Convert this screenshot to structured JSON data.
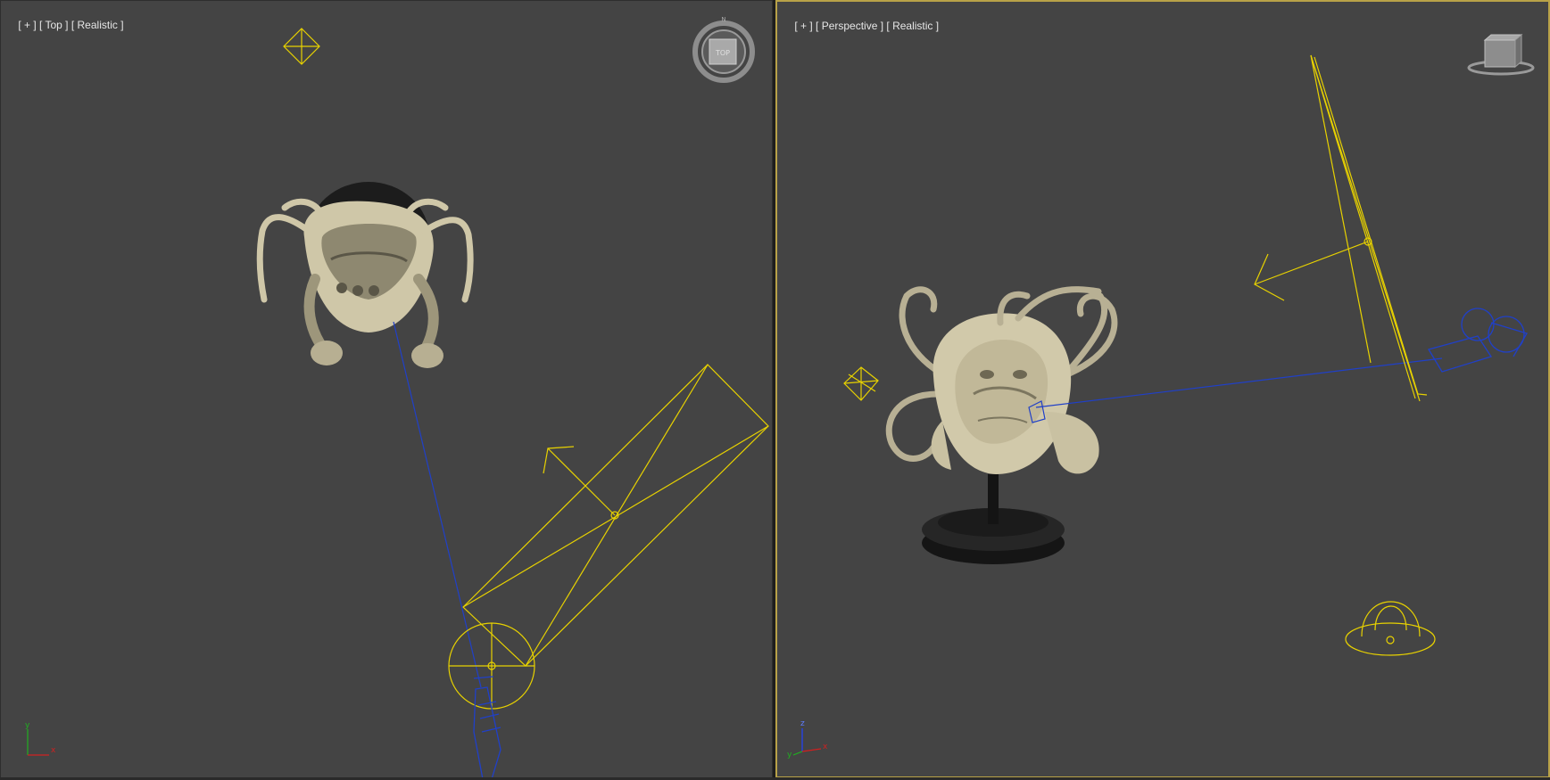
{
  "viewports": {
    "left": {
      "menu_label": "[ + ]",
      "view_label": "[ Top ]",
      "shading_label": "[ Realistic ]",
      "viewcube_label": "TOP"
    },
    "right": {
      "menu_label": "[ + ]",
      "view_label": "[ Perspective ]",
      "shading_label": "[ Realistic ]"
    }
  },
  "axis": {
    "x": "x",
    "y": "y",
    "z": "z"
  },
  "colors": {
    "viewport_bg": "#444444",
    "active_border": "#b8a248",
    "light_gizmo": "#e8d200",
    "target_link": "#2040c8",
    "model": "#cfc7a8",
    "axis_x": "#d02020",
    "axis_y": "#20b020",
    "axis_z": "#2040ff"
  }
}
